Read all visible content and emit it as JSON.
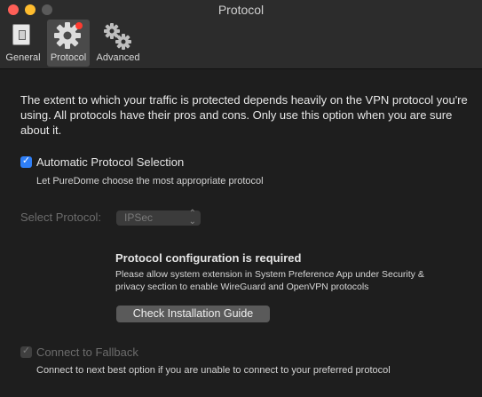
{
  "window": {
    "title": "Protocol"
  },
  "tabs": [
    {
      "label": "General",
      "icon": "switch-icon",
      "selected": false
    },
    {
      "label": "Protocol",
      "icon": "gear-icon",
      "selected": true
    },
    {
      "label": "Advanced",
      "icon": "gears-icon",
      "selected": false
    }
  ],
  "content": {
    "description": "The extent to which your traffic is protected depends heavily on the VPN protocol you're using. All protocols have their pros and cons. Only use this option when you are sure about it.",
    "auto_protocol": {
      "label": "Automatic Protocol Selection",
      "checked": true,
      "help": "Let PureDome choose the most appropriate protocol"
    },
    "select_protocol": {
      "label": "Select Protocol:",
      "value": "IPSec",
      "enabled": false
    },
    "config_notice": {
      "title": "Protocol configuration is required",
      "body": "Please allow system extension in System Preference App under Security & privacy section to enable WireGuard and OpenVPN protocols",
      "button": "Check Installation Guide"
    },
    "fallback": {
      "label": "Connect to Fallback",
      "checked": true,
      "enabled": false,
      "help": "Connect to next best option if you are unable to connect to your preferred protocol"
    }
  },
  "colors": {
    "accent": "#2f7ff7",
    "background": "#1e1e1e",
    "badge": "#ff3b30"
  }
}
